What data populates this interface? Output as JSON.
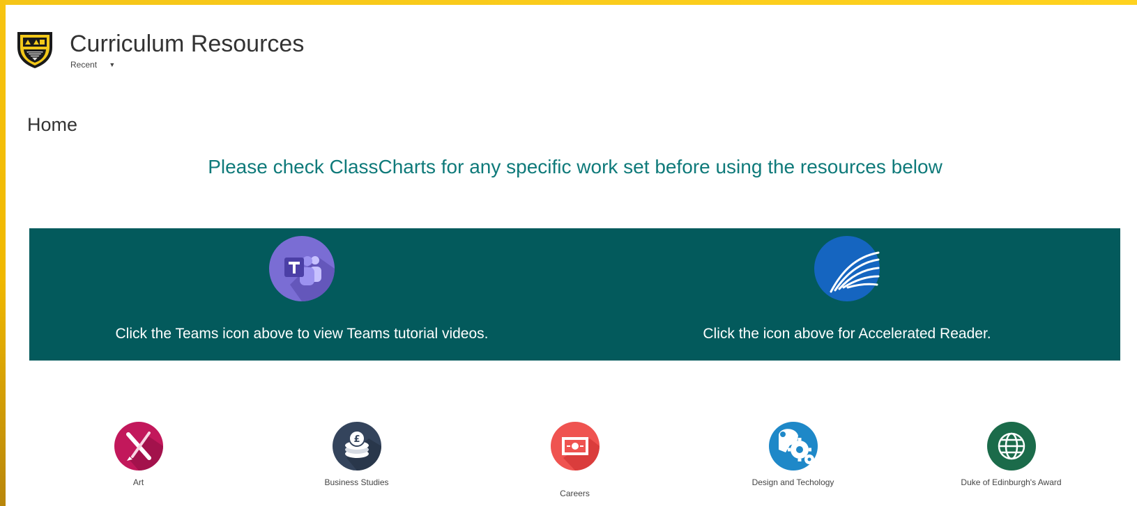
{
  "site": {
    "title": "Curriculum Resources",
    "recent_label": "Recent",
    "logo_icon": "school-crest-icon"
  },
  "page": {
    "title": "Home",
    "notice": "Please check ClassCharts for any specific work set before using the resources below"
  },
  "feature_band": {
    "background_color": "#035a5c",
    "items": [
      {
        "icon": "microsoft-teams-icon",
        "caption": "Click the Teams icon above to view Teams tutorial videos."
      },
      {
        "icon": "accelerated-reader-icon",
        "caption": "Click the icon above for Accelerated Reader."
      }
    ]
  },
  "subjects": [
    {
      "label": "Art",
      "icon": "paintbrush-icon",
      "color": "#c2185b"
    },
    {
      "label": "Business Studies",
      "icon": "coins-icon",
      "color": "#34445c"
    },
    {
      "label": "Careers",
      "icon": "certificate-icon",
      "color": "#ef5350"
    },
    {
      "label": "Design and Techology",
      "icon": "head-gears-icon",
      "color": "#1e88c8"
    },
    {
      "label": "Duke of Edinburgh's Award",
      "icon": "globe-icon",
      "color": "#1b6b4a"
    }
  ],
  "colors": {
    "frame": "#f5c518",
    "notice_text": "#0f7a7a",
    "teams_purple": "#7a6dd4",
    "reader_blue": "#1565c0"
  }
}
